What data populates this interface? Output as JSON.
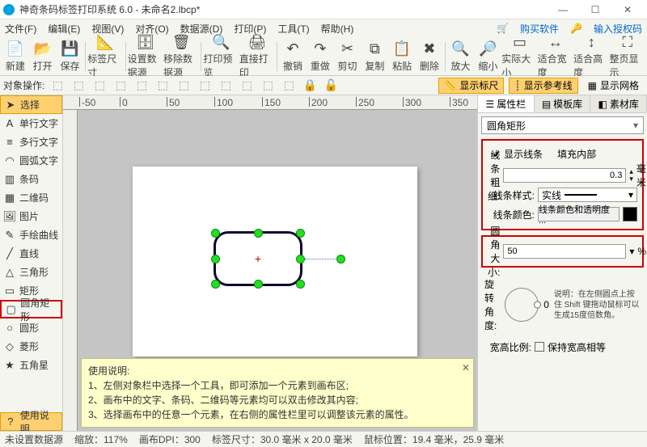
{
  "title": "神奇条码标签打印系统 6.0 - 未命名2.lbcp*",
  "menu": {
    "file": "文件(F)",
    "edit": "编辑(E)",
    "view": "视图(V)",
    "align": "对齐(O)",
    "datasource": "数据源(D)",
    "print": "打印(P)",
    "tools": "工具(T)",
    "help": "帮助(H)",
    "buy": "购买软件",
    "auth": "输入授权码"
  },
  "toolbar": {
    "new": "新建",
    "open": "打开",
    "save": "保存",
    "labelsize": "标签尺寸",
    "setds": "设置数据源",
    "movds": "移除数据源",
    "preview": "打印预览",
    "print": "直接打印",
    "undo": "撤销",
    "redo": "重做",
    "cut": "剪切",
    "copy": "复制",
    "paste": "粘贴",
    "delete": "删除",
    "zoomin": "放大",
    "zoomout": "缩小",
    "actual": "实际大小",
    "fitw": "适合宽度",
    "fith": "适合高度",
    "full": "整页显示"
  },
  "tb2": {
    "label": "对象操作:",
    "ruler": "显示标尺",
    "guide": "显示参考线",
    "grid": "显示网格"
  },
  "tools": {
    "select": "选择",
    "text": "单行文字",
    "mtext": "多行文字",
    "arctext": "圆弧文字",
    "barcode": "条码",
    "qrcode": "二维码",
    "image": "图片",
    "freehand": "手绘曲线",
    "line": "直线",
    "triangle": "三角形",
    "rect": "矩形",
    "roundrect": "圆角矩形",
    "ellipse": "圆形",
    "rhombus": "菱形",
    "star": "五角星",
    "usage": "使用说明"
  },
  "tabs": {
    "props": "属性栏",
    "tpl": "模板库",
    "mat": "素材库"
  },
  "props": {
    "shapename": "圆角矩形",
    "showline": "显示线条",
    "fillinner": "填充内部",
    "linewidth_lbl": "线条粗细:",
    "linewidth": "0.3",
    "mm": "毫米",
    "linestyle_lbl": "线条样式:",
    "linestyle": "实线",
    "linecolor_lbl": "线条颜色:",
    "linecolor_btn": "线条颜色和透明度 ...",
    "radius_lbl": "圆角大小:",
    "radius": "50",
    "pct": "%",
    "rot_lbl": "旋转角度:",
    "rotval": "0",
    "rot_tip": "说明：在左侧圆点上按住 Shift 键拖动鼠标可以生成15度倍数角。",
    "aspect_lbl": "宽高比例:",
    "aspect_keep": "保持宽高相等"
  },
  "help": {
    "title": "使用说明:",
    "l1": "1、左侧对象栏中选择一个工具，即可添加一个元素到画布区;",
    "l2": "2、画布中的文字、条码、二维码等元素均可以双击修改其内容;",
    "l3": "3、选择画布中的任意一个元素，在右侧的属性栏里可以调整该元素的属性。"
  },
  "status": {
    "ds": "未设置数据源",
    "zoom": "缩放：117%",
    "dpi": "画布DPI：300",
    "size": "标签尺寸：30.0 毫米 x 20.0 毫米",
    "pos": "鼠标位置：19.4 毫米，25.9 毫米"
  },
  "ruler": {
    "t_50": "-50",
    "t0": "0",
    "t50": "50",
    "t100": "100",
    "t150": "150",
    "t200": "200",
    "t250": "250",
    "t300": "300",
    "t350": "350"
  }
}
